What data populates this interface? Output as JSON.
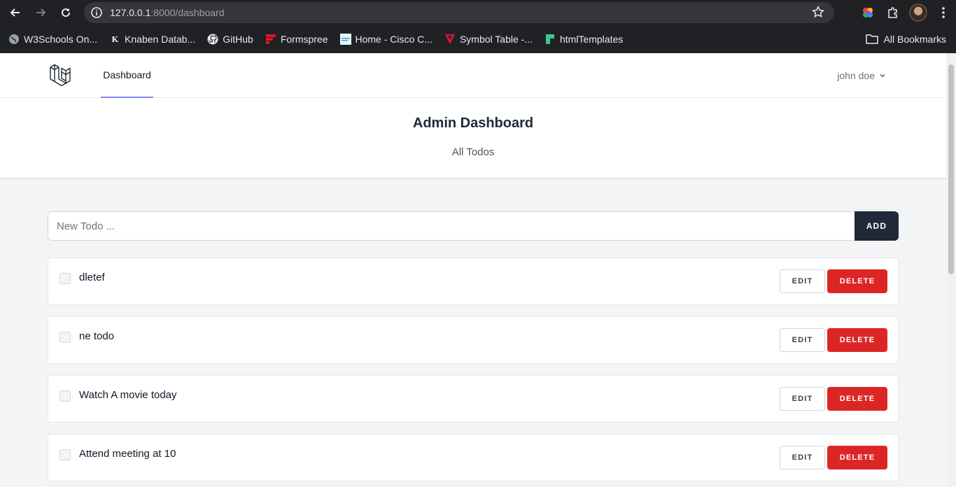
{
  "browser": {
    "url_host": "127.0.0.1",
    "url_rest": ":8000/dashboard",
    "bookmarks": [
      {
        "label": "W3Schools On...",
        "icon": "globe-icon"
      },
      {
        "label": "Knaben Datab...",
        "icon": "knaben-icon"
      },
      {
        "label": "GitHub",
        "icon": "github-icon"
      },
      {
        "label": "Formspree",
        "icon": "formspree-icon"
      },
      {
        "label": "Home - Cisco C...",
        "icon": "cisco-icon"
      },
      {
        "label": "Symbol Table -...",
        "icon": "symbol-table-icon"
      },
      {
        "label": "htmlTemplates",
        "icon": "htmltemplates-icon"
      }
    ],
    "all_bookmarks": "All Bookmarks"
  },
  "nav": {
    "dashboard_link": "Dashboard",
    "user_name": "john doe"
  },
  "header": {
    "title": "Admin Dashboard",
    "subtitle": "All Todos"
  },
  "new_todo": {
    "placeholder": "New Todo ...",
    "value": "",
    "add_label": "ADD"
  },
  "todos": [
    {
      "text": "dletef",
      "checked": false
    },
    {
      "text": "ne todo",
      "checked": false
    },
    {
      "text": "Watch A movie today",
      "checked": false
    },
    {
      "text": "Attend meeting at 10",
      "checked": false
    }
  ],
  "actions": {
    "edit_label": "EDIT",
    "delete_label": "DELETE"
  },
  "colors": {
    "accent": "#818cf8",
    "add_button": "#1f2937",
    "delete_button": "#dc2626"
  }
}
